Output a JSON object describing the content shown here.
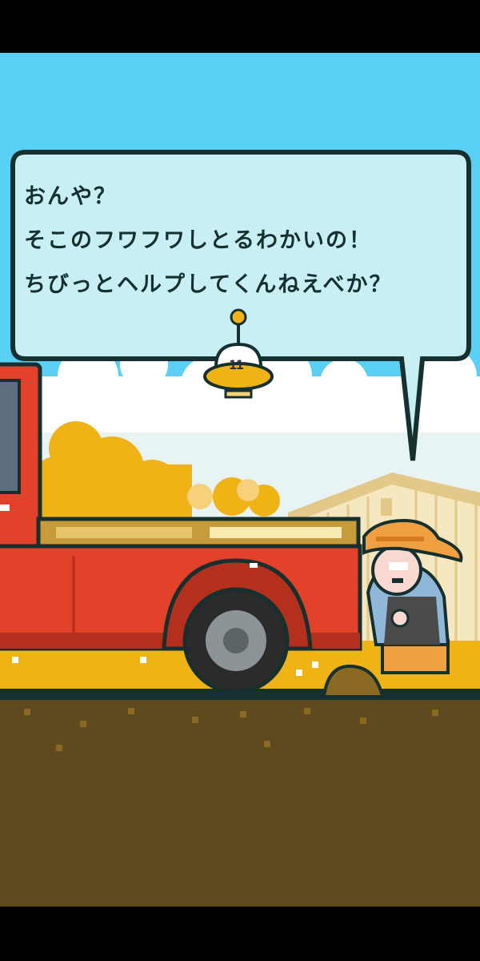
{
  "dialogue": {
    "lines": [
      "おんや？",
      "そこのフワフワしとるわかいの！",
      "ちびっとヘルプしてくんねえべか？"
    ]
  },
  "ufo": {
    "level": "11"
  },
  "colors": {
    "sky": "#5ad0f5",
    "bubble_fill": "#c8f0f4",
    "bubble_border": "#15302e",
    "truck_red": "#e2412a",
    "ground_dirt": "#5e4a1e",
    "grass_yellow": "#f0b316",
    "farmer_hat": "#f0a040"
  },
  "icons": [
    "ufo-character-icon",
    "farmer-character-icon",
    "pickup-truck-icon"
  ]
}
